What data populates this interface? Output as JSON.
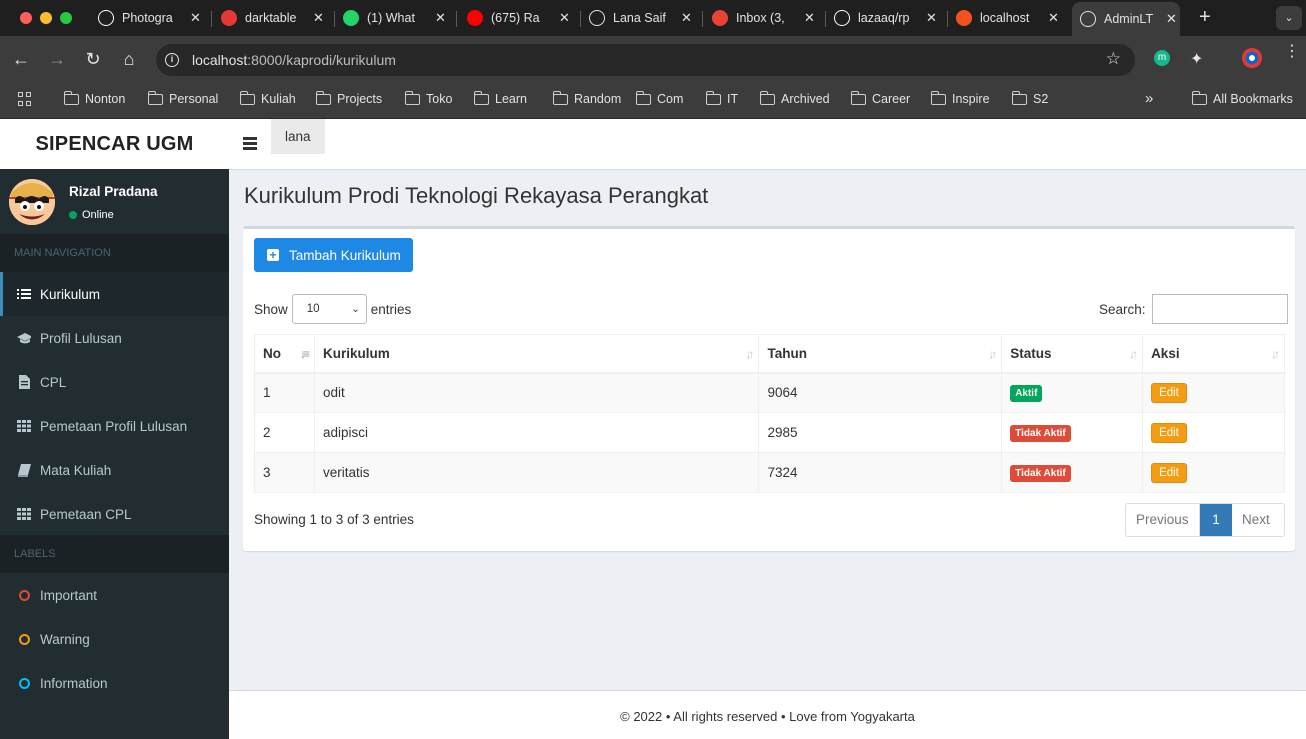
{
  "browser": {
    "tabs": [
      {
        "title": "Photogra",
        "icon": "aperture-icon",
        "color": "#ffffff"
      },
      {
        "title": "darktable",
        "icon": "darktable-icon",
        "color": "#e53935"
      },
      {
        "title": "(1) What",
        "icon": "whatsapp-icon",
        "color": "#25d366"
      },
      {
        "title": "(675) Ra",
        "icon": "youtube-icon",
        "color": "#ff0000"
      },
      {
        "title": "Lana Saif",
        "icon": "globe-icon",
        "color": "#e3e3e3"
      },
      {
        "title": "Inbox (3,",
        "icon": "gmail-icon",
        "color": "#ea4335"
      },
      {
        "title": "lazaaq/rp",
        "icon": "github-icon",
        "color": "#ffffff"
      },
      {
        "title": "localhost",
        "icon": "laravel-icon",
        "color": "#f4511e"
      },
      {
        "title": "AdminLT",
        "icon": "globe-icon",
        "color": "#e3e3e3",
        "active": true
      }
    ],
    "url_host": "localhost",
    "url_path": ":8000/kaprodi/kurikulum",
    "bookmarks": [
      "Nonton",
      "Personal",
      "Kuliah",
      "Projects",
      "Toko",
      "Learn",
      "Random",
      "Com",
      "IT",
      "Archived",
      "Career",
      "Inspire",
      "S2"
    ],
    "all_bookmarks": "All Bookmarks",
    "more_bookmarks": "»"
  },
  "app": {
    "logo": "SIPENCAR UGM",
    "user": {
      "name": "Rizal Pradana",
      "status": "Online"
    },
    "top_tab": "lana",
    "nav_header": "MAIN NAVIGATION",
    "nav_items": [
      {
        "label": "Kurikulum",
        "icon": "list-icon",
        "active": true
      },
      {
        "label": "Profil Lulusan",
        "icon": "graduation-cap-icon"
      },
      {
        "label": "CPL",
        "icon": "file-icon"
      },
      {
        "label": "Pemetaan Profil Lulusan",
        "icon": "grid-icon"
      },
      {
        "label": "Mata Kuliah",
        "icon": "book-icon"
      },
      {
        "label": "Pemetaan CPL",
        "icon": "grid-icon"
      }
    ],
    "labels_header": "LABELS",
    "labels": [
      {
        "label": "Important",
        "color": "#dd4b39"
      },
      {
        "label": "Warning",
        "color": "#f39c12"
      },
      {
        "label": "Information",
        "color": "#00c0ef"
      }
    ]
  },
  "main": {
    "title": "Kurikulum Prodi Teknologi Rekayasa Perangkat",
    "add_button": "Tambah Kurikulum",
    "show_label": "Show",
    "entries_label": "entries",
    "page_length": "10",
    "search_label": "Search:",
    "columns": [
      "No",
      "Kurikulum",
      "Tahun",
      "Status",
      "Aksi"
    ],
    "rows": [
      {
        "no": "1",
        "kurikulum": "odit",
        "tahun": "9064",
        "status": "Aktif",
        "status_color": "#00a65a",
        "aksi": "Edit"
      },
      {
        "no": "2",
        "kurikulum": "adipisci",
        "tahun": "2985",
        "status": "Tidak Aktif",
        "status_color": "#dd4b39",
        "aksi": "Edit"
      },
      {
        "no": "3",
        "kurikulum": "veritatis",
        "tahun": "7324",
        "status": "Tidak Aktif",
        "status_color": "#dd4b39",
        "aksi": "Edit"
      }
    ],
    "info": "Showing 1 to 3 of 3 entries",
    "pagination": {
      "previous": "Previous",
      "current": "1",
      "next": "Next"
    }
  },
  "footer": "© 2022 • All rights reserved • Love from Yogyakarta"
}
